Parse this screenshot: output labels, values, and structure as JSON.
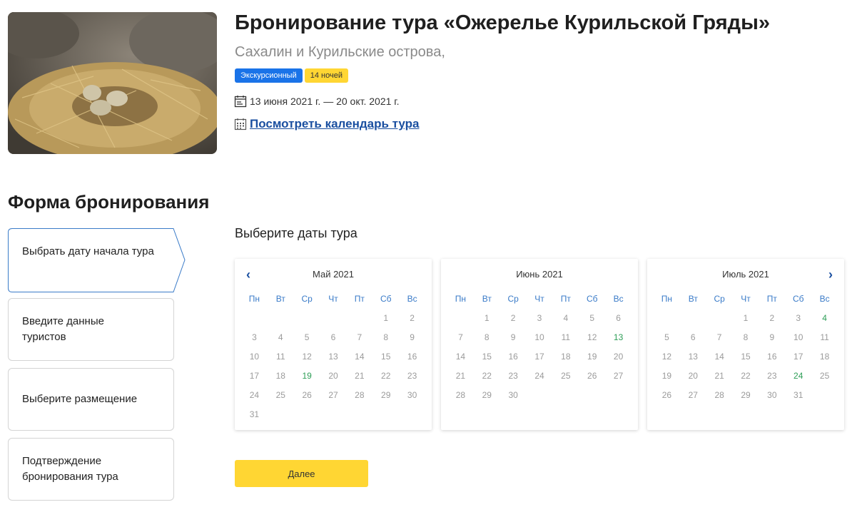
{
  "tour": {
    "title": "Бронирование тура «Ожерелье Курильской Гряды»",
    "region": "Сахалин и Курильские острова,",
    "badges": {
      "type": "Экскурсионный",
      "nights": "14 ночей"
    },
    "dates": "13 июня 2021 г. — 20 окт. 2021 г.",
    "calendar_link": "Посмотреть календарь тура",
    "photo": "bird-nest-with-eggs-photo"
  },
  "form": {
    "title": "Форма бронирования",
    "steps": [
      {
        "label": "Выбрать дату начала тура",
        "active": true
      },
      {
        "label": "Введите данные туристов",
        "active": false
      },
      {
        "label": "Выберите размещение",
        "active": false
      },
      {
        "label": "Подтверждение бронирования тура",
        "active": false
      }
    ],
    "select_title": "Выберите даты тура",
    "next_label": "Далее"
  },
  "calendar": {
    "weekdays": [
      "Пн",
      "Вт",
      "Ср",
      "Чт",
      "Пт",
      "Сб",
      "Вс"
    ],
    "prev_icon": "chevron-left-icon",
    "next_icon": "chevron-right-icon",
    "months": [
      {
        "label": "Май 2021",
        "offset": 5,
        "days": 31,
        "available": [
          19
        ]
      },
      {
        "label": "Июнь 2021",
        "offset": 1,
        "days": 30,
        "available": [
          13
        ]
      },
      {
        "label": "Июль 2021",
        "offset": 3,
        "days": 31,
        "available": [
          4,
          24
        ]
      }
    ]
  },
  "colors": {
    "accent_yellow": "#ffd633",
    "badge_blue": "#1a73e8",
    "link_blue": "#1a4fa0",
    "available_green": "#2e9e57",
    "weekday_blue": "#3a7bc8"
  }
}
